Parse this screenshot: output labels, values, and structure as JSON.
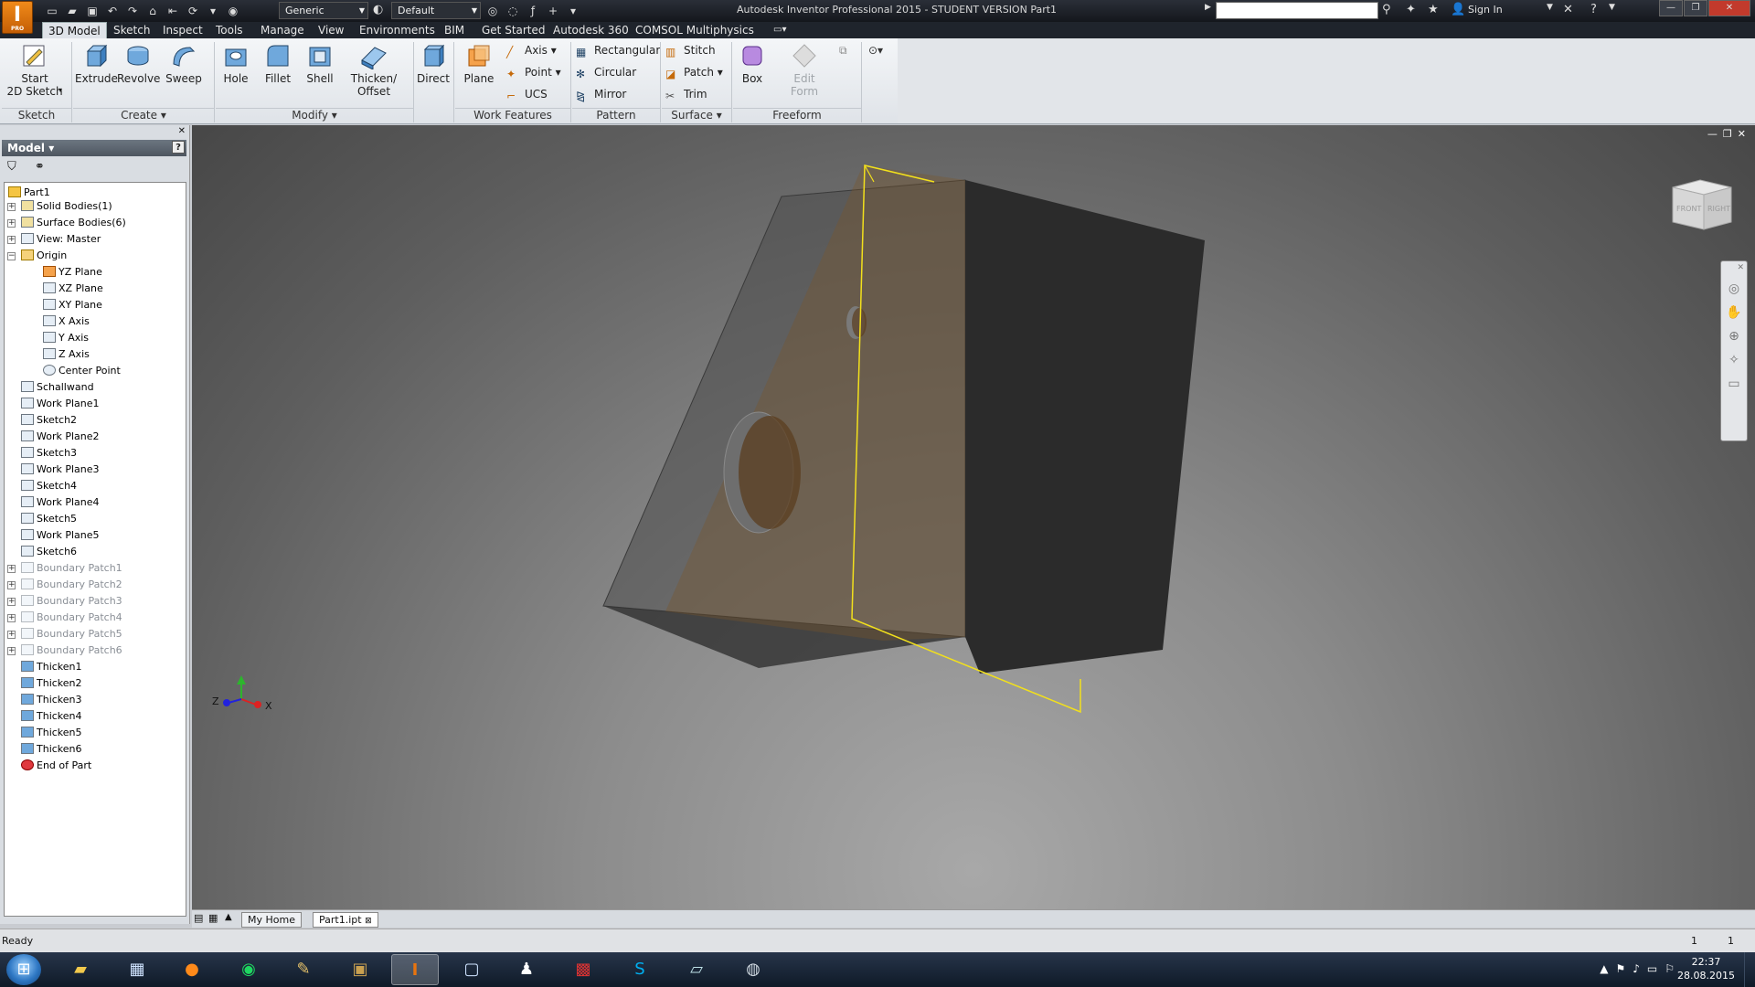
{
  "app": {
    "logo_letter": "I",
    "logo_sub": "PRO",
    "title": "Autodesk Inventor Professional 2015 - STUDENT VERSION    Part1",
    "material_combo": "Generic",
    "appearance_combo": "Default",
    "search_placeholder": "",
    "signin": "Sign In",
    "help": "?"
  },
  "tabs": [
    "3D Model",
    "Sketch",
    "Inspect",
    "Tools",
    "Manage",
    "View",
    "Environments",
    "BIM",
    "Get Started",
    "Autodesk 360",
    "COMSOL Multiphysics"
  ],
  "ribbon": {
    "start_sketch": "Start\n2D Sketch",
    "extrude": "Extrude",
    "revolve": "Revolve",
    "sweep": "Sweep",
    "hole": "Hole",
    "fillet": "Fillet",
    "shell": "Shell",
    "thicken": "Thicken/\nOffset",
    "direct": "Direct",
    "plane": "Plane",
    "axis": "Axis",
    "point": "Point",
    "ucs": "UCS",
    "rectangular": "Rectangular",
    "circular": "Circular",
    "mirror": "Mirror",
    "stitch": "Stitch",
    "patch": "Patch",
    "trim": "Trim",
    "box": "Box",
    "edit_form": "Edit\nForm",
    "panels": {
      "sketch": "Sketch",
      "create": "Create",
      "modify": "Modify",
      "work_features": "Work Features",
      "pattern": "Pattern",
      "surface": "Surface",
      "freeform": "Freeform"
    }
  },
  "browser": {
    "title": "Model",
    "help": "?",
    "tree": [
      "Part1",
      "Solid Bodies(1)",
      "Surface Bodies(6)",
      "View: Master",
      "Origin",
      "YZ Plane",
      "XZ Plane",
      "XY Plane",
      "X Axis",
      "Y Axis",
      "Z Axis",
      "Center Point",
      "Schallwand",
      "Work Plane1",
      "Sketch2",
      "Work Plane2",
      "Sketch3",
      "Work Plane3",
      "Sketch4",
      "Work Plane4",
      "Sketch5",
      "Work Plane5",
      "Sketch6",
      "Boundary Patch1",
      "Boundary Patch2",
      "Boundary Patch3",
      "Boundary Patch4",
      "Boundary Patch5",
      "Boundary Patch6",
      "Thicken1",
      "Thicken2",
      "Thicken3",
      "Thicken4",
      "Thicken5",
      "Thicken6",
      "End of Part"
    ]
  },
  "viewport": {
    "viewcube_front": "FRONT",
    "viewcube_right": "RIGHT",
    "axis_z": "Z",
    "axis_x": "X"
  },
  "doc_tabs": [
    "My Home",
    "Part1.ipt"
  ],
  "status": {
    "text": "Ready",
    "num1": "1",
    "num2": "1"
  },
  "taskbar": {
    "time": "22:37",
    "date": "28.08.2015"
  },
  "colors": {
    "accent_orange": "#e8740f",
    "sketch_yellow": "#f2e01c",
    "viewport_gray": "#7a7a7a"
  }
}
